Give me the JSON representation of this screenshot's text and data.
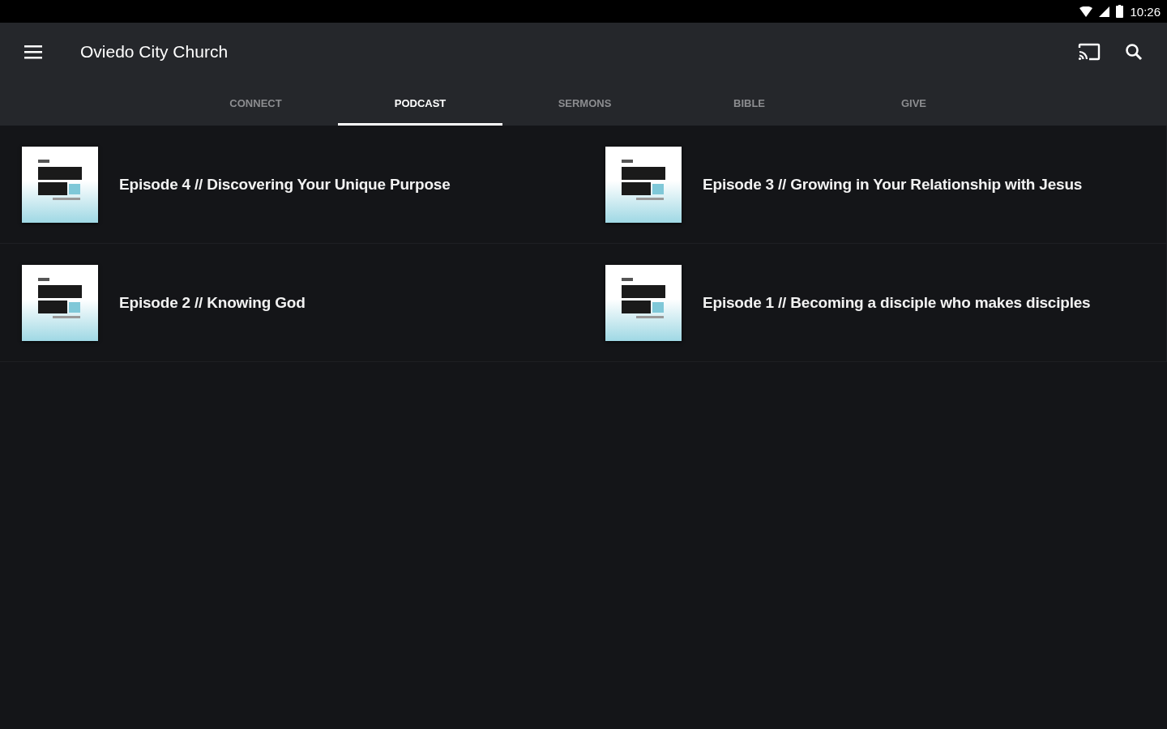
{
  "status_bar": {
    "time": "10:26"
  },
  "app_bar": {
    "title": "Oviedo City Church"
  },
  "tabs": [
    {
      "label": "CONNECT",
      "selected": false
    },
    {
      "label": "PODCAST",
      "selected": true
    },
    {
      "label": "SERMONS",
      "selected": false
    },
    {
      "label": "BIBLE",
      "selected": false
    },
    {
      "label": "GIVE",
      "selected": false
    }
  ],
  "episodes": [
    {
      "title": "Episode 4 // Discovering Your Unique Purpose"
    },
    {
      "title": "Episode 3 // Growing in Your Relationship with Jesus"
    },
    {
      "title": "Episode 2 // Knowing God"
    },
    {
      "title": "Episode 1 // Becoming a disciple who makes disciples"
    }
  ]
}
